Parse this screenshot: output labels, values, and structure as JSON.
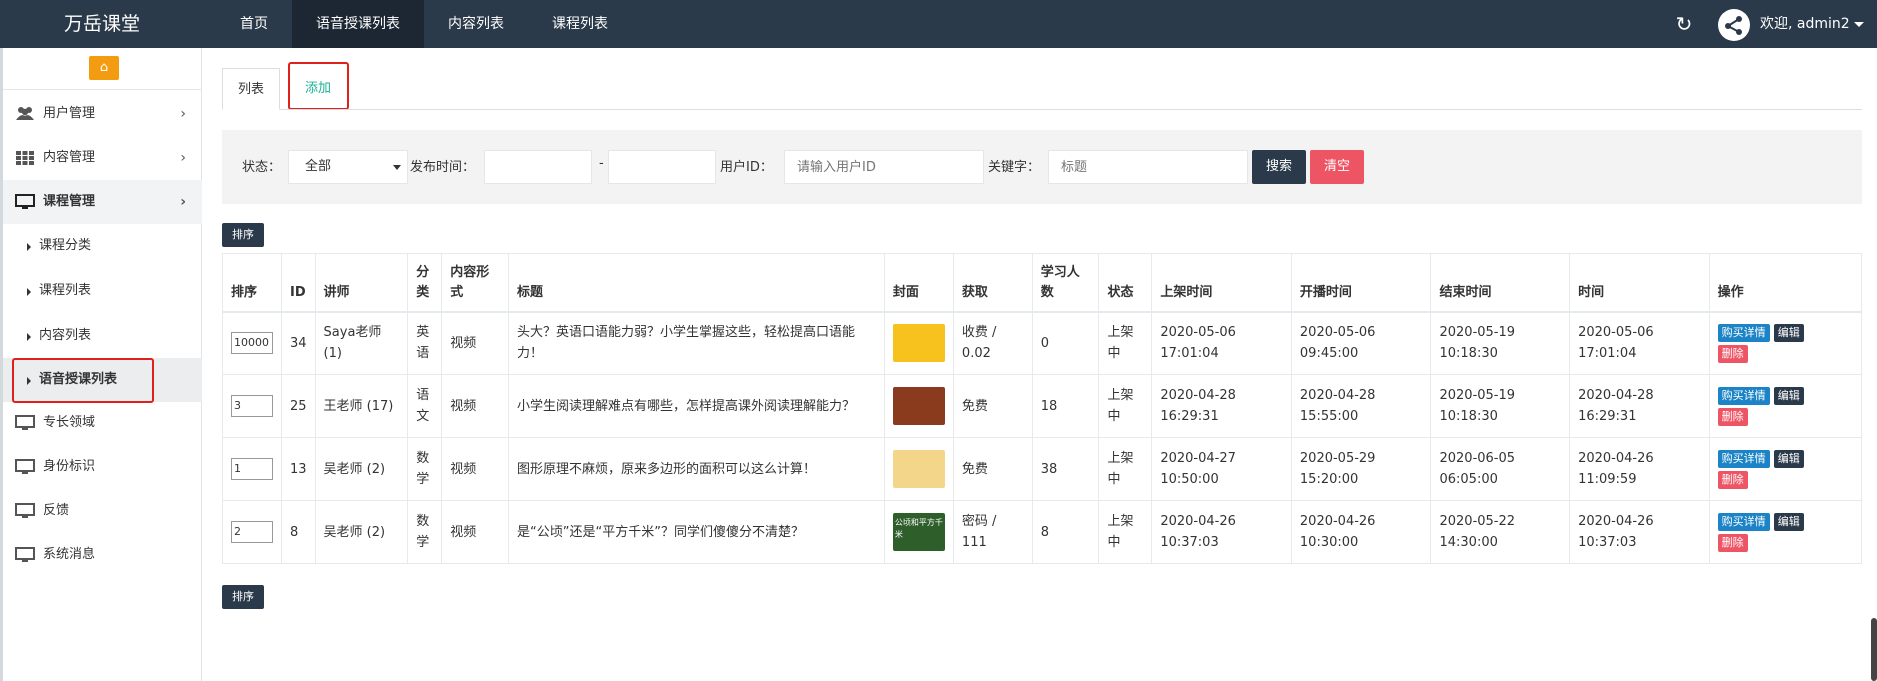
{
  "brand": "万岳课堂",
  "topnav": [
    "首页",
    "语音授课列表",
    "内容列表",
    "课程列表"
  ],
  "user": {
    "welcome": "欢迎, admin2"
  },
  "sidebar": {
    "items": [
      {
        "label": "用户管理",
        "icon": "users-icon"
      },
      {
        "label": "内容管理",
        "icon": "grid-icon"
      },
      {
        "label": "课程管理",
        "icon": "monitor-icon"
      }
    ],
    "subitems": [
      "课程分类",
      "课程列表",
      "内容列表",
      "语音授课列表"
    ],
    "bottom_items": [
      "专长领域",
      "身份标识",
      "反馈",
      "系统消息"
    ]
  },
  "tabs": {
    "list": "列表",
    "add": "添加"
  },
  "filter": {
    "status_label": "状态：",
    "status_value": "全部",
    "time_label": "发布时间：",
    "dash": "-",
    "uid_label": "用户ID：",
    "uid_placeholder": "请输入用户ID",
    "keyword_label": "关键字：",
    "keyword_placeholder": "标题",
    "search_btn": "搜索",
    "clear_btn": "清空"
  },
  "sort_btn": "排序",
  "table": {
    "headers": [
      "排序",
      "ID",
      "讲师",
      "分类",
      "内容形式",
      "标题",
      "封面",
      "获取",
      "学习人数",
      "状态",
      "上架时间",
      "开播时间",
      "结束时间",
      "时间",
      "操作"
    ],
    "rows": [
      {
        "sort": "10000",
        "id": "34",
        "teacher": "Saya老师 (1)",
        "category": "英语",
        "form": "视频",
        "title": "头大？英语口语能力弱？小学生掌握这些，轻松提高口语能力！",
        "access": "收费 / 0.02",
        "learners": "0",
        "status": "上架中",
        "listed": "2020-05-06 17:01:04",
        "start": "2020-05-06 09:45:00",
        "end": "2020-05-19 10:18:30",
        "time": "2020-05-06 17:01:04"
      },
      {
        "sort": "3",
        "id": "25",
        "teacher": "王老师 (17)",
        "category": "语文",
        "form": "视频",
        "title": "小学生阅读理解难点有哪些，怎样提高课外阅读理解能力？",
        "access": "免费",
        "learners": "18",
        "status": "上架中",
        "listed": "2020-04-28 16:29:31",
        "start": "2020-04-28 15:55:00",
        "end": "2020-05-19 10:18:30",
        "time": "2020-04-28 16:29:31"
      },
      {
        "sort": "1",
        "id": "13",
        "teacher": "吴老师 (2)",
        "category": "数学",
        "form": "视频",
        "title": "图形原理不麻烦，原来多边形的面积可以这么计算！",
        "access": "免费",
        "learners": "38",
        "status": "上架中",
        "listed": "2020-04-27 10:50:00",
        "start": "2020-05-29 15:20:00",
        "end": "2020-06-05 06:05:00",
        "time": "2020-04-26 11:09:59"
      },
      {
        "sort": "2",
        "id": "8",
        "teacher": "吴老师 (2)",
        "category": "数学",
        "form": "视频",
        "title": "是“公顷”还是“平方千米”？同学们傻傻分不清楚？",
        "access": "密码 / 111",
        "learners": "8",
        "status": "上架中",
        "listed": "2020-04-26 10:37:03",
        "start": "2020-04-26 10:30:00",
        "end": "2020-05-22 14:30:00",
        "time": "2020-04-26 10:37:03"
      }
    ],
    "ops": {
      "detail": "购买详情",
      "edit": "编辑",
      "delete": "删除"
    },
    "covers": [
      {
        "text": "",
        "bg": "#f7c21e"
      },
      {
        "text": "",
        "bg": "#8a3b1e"
      },
      {
        "text": "",
        "bg": "#f4d68a"
      },
      {
        "text": "公顷和平方千米",
        "bg": "#2e5e2a"
      }
    ]
  }
}
